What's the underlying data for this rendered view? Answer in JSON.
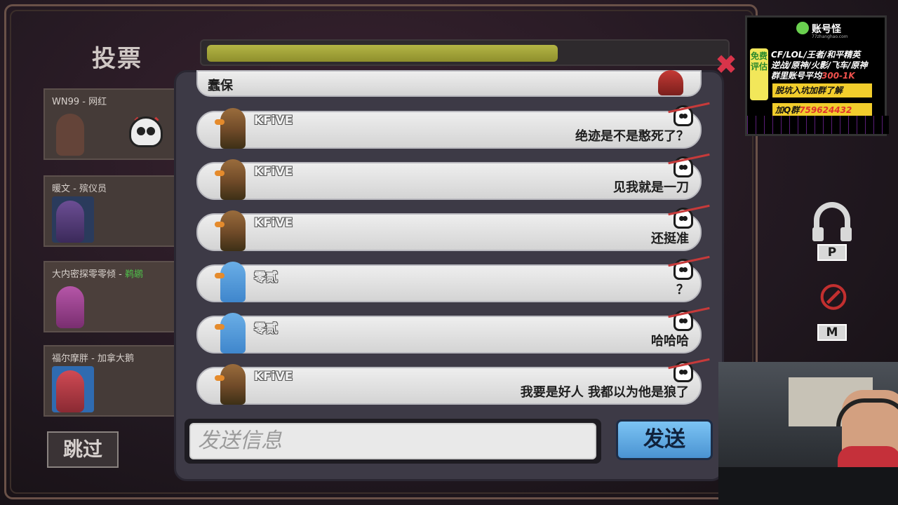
{
  "vote": {
    "title": "投票",
    "timer_progress": 0.68,
    "skip_label": "跳过"
  },
  "players": [
    {
      "name": "WN99",
      "role": "网红",
      "status": "dead"
    },
    {
      "name": "暖文",
      "role": "殡仪员",
      "status": "alive"
    },
    {
      "name": "大内密探零零倾",
      "role": "鹈鹕",
      "status": "alive"
    },
    {
      "name": "福尔摩胖",
      "role": "加拿大鹅",
      "status": "alive"
    }
  ],
  "chat": {
    "messages": [
      {
        "sender": "",
        "text": "蠢保",
        "avatar": "red"
      },
      {
        "sender": "KFiVE",
        "text": "绝迹是不是憨死了？",
        "avatar": "brown"
      },
      {
        "sender": "KFiVE",
        "text": "见我就是一刀",
        "avatar": "brown"
      },
      {
        "sender": "KFiVE",
        "text": "还挺准",
        "avatar": "brown"
      },
      {
        "sender": "零贰",
        "text": "？",
        "avatar": "blue"
      },
      {
        "sender": "零贰",
        "text": "哈哈哈",
        "avatar": "blue"
      },
      {
        "sender": "KFiVE",
        "text": "我要是好人 我都以为他是狼了",
        "avatar": "brown"
      }
    ],
    "input_placeholder": "发送信息",
    "send_label": "发送"
  },
  "controls": {
    "push_to_talk_key": "P",
    "mute_key": "M"
  },
  "ad": {
    "brand": "账号怪",
    "site": "77zhanghao.com",
    "badge": "免费评估",
    "line1": "CF/LOL/王者/和平精英",
    "line2": "逆战/原神/火影/飞车/原神",
    "line3_prefix": "群里账号平均",
    "line3_value": "300-1K",
    "bar1": "脱坑入坑加群了解",
    "qq_prefix": "加Q群",
    "qq_number": "759624432"
  },
  "colors": {
    "timer_fill": "#a8aa3e",
    "send_button": "#5fa8e4",
    "accent_red": "#c73a3a",
    "role_green": "#4fbf4a"
  }
}
